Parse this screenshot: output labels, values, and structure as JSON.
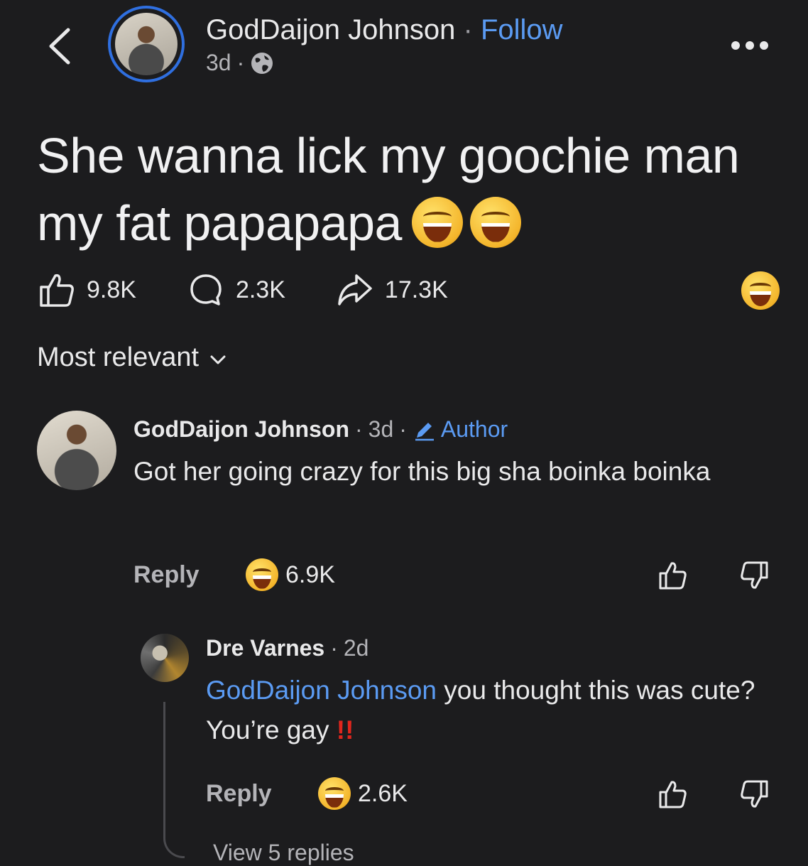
{
  "header": {
    "author_name": "GodDaijon Johnson",
    "separator": "·",
    "follow_label": "Follow",
    "time": "3d",
    "meta_separator": "·",
    "privacy_icon": "globe-icon"
  },
  "post": {
    "text": "She wanna lick my goochie man my fat papapapa",
    "emojis": [
      "rolling-on-floor-laughing",
      "rolling-on-floor-laughing"
    ],
    "likes": "9.8K",
    "comments": "2.3K",
    "shares": "17.3K"
  },
  "sort": {
    "label": "Most relevant"
  },
  "comments": [
    {
      "name": "GodDaijon Johnson",
      "sep": "·",
      "time": "3d",
      "sep2": "·",
      "badge": "Author",
      "text": "Got her going crazy for this big sha boinka boinka",
      "reply_label": "Reply",
      "reaction_count": "6.9K"
    },
    {
      "name": "Dre Varnes",
      "sep": "·",
      "time": "2d",
      "mention": "GodDaijon Johnson",
      "text": " you thought this was cute? You’re gay ",
      "emphasis": "!!",
      "reply_label": "Reply",
      "reaction_count": "2.6K",
      "view_replies": "View 5 replies"
    }
  ],
  "colors": {
    "background": "#1c1c1e",
    "link": "#5b9bf3",
    "ring": "#2f6fe0",
    "alert": "#e0261d"
  }
}
